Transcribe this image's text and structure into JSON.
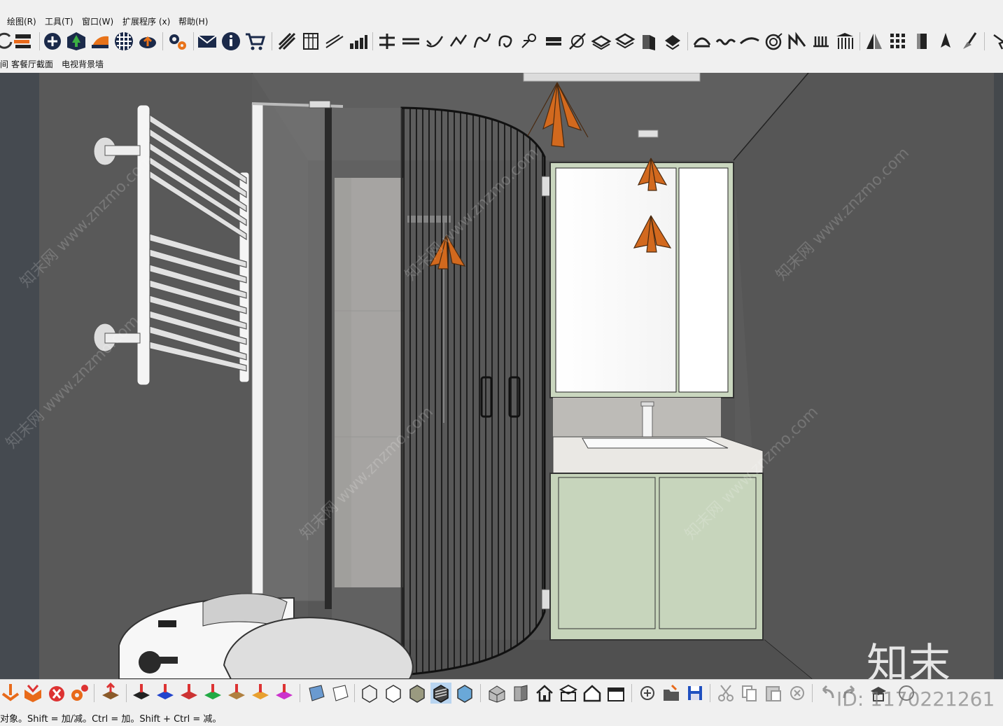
{
  "menubar": {
    "items": [
      "绘图(R)",
      "工具(T)",
      "窗口(W)",
      "扩展程序 (x)",
      "帮助(H)"
    ]
  },
  "toolbar_top": {
    "icons": [
      "rotate-icon",
      "layers-icon",
      "add-circle-icon",
      "house-green-icon",
      "sandbox-icon",
      "checker-sphere-icon",
      "cloud-upload-icon",
      "gear-icon",
      "mail-icon",
      "info-icon",
      "cart-icon",
      "stair-icon",
      "column-icon",
      "line-icon",
      "bar-chart-icon",
      "align-icon",
      "arc-icon",
      "curve-icon",
      "path-icon",
      "bezier-icon",
      "loop-icon",
      "node-icon",
      "flatten-icon",
      "draw-icon",
      "stack-icon",
      "stack2-icon",
      "extrude-icon",
      "push-icon",
      "shape-icon",
      "wave-icon",
      "spiral-icon",
      "roof-icon",
      "rail-icon",
      "temple-icon",
      "mirror-icon",
      "grid-icon",
      "panel-icon",
      "pen-icon",
      "brush-icon"
    ]
  },
  "scene_tabs": [
    "客餐厅截面",
    "电视背景墙"
  ],
  "scene_tab_prefix": "间",
  "toolbar_bottom": {
    "icons": [
      "drop-icon",
      "fold-icon",
      "bolt-icon",
      "gear2-icon",
      "move-up-icon",
      "arrow-red-icon",
      "arrow-blue-icon",
      "arrow-r-icon",
      "arrow-v-icon",
      "arrow-n-icon",
      "arrow-x-icon",
      "arrow-f-icon",
      "face-icon",
      "face2-icon",
      "box-wire-icon",
      "box-hidden-icon",
      "box-shaded-icon",
      "box-texture-icon",
      "box-mono-icon",
      "iso-icon",
      "front-icon",
      "home-icon",
      "top-icon",
      "house-icon",
      "side-icon",
      "zoom-icon",
      "open-icon",
      "save-icon",
      "cut-icon",
      "copy-icon",
      "paste-icon",
      "delete-icon",
      "undo-icon",
      "redo-icon",
      "print-icon",
      "help-icon"
    ]
  },
  "status": {
    "text": "对象。Shift = 加/减。Ctrl = 加。Shift + Ctrl = 减。"
  },
  "watermark": {
    "text": "知末网 www.znzmo.com",
    "logo": "知末",
    "id": "ID: 1170221261"
  },
  "colors": {
    "wall": "#5b5b5b",
    "cabinet": "#c9d6bd",
    "accent_orange": "#d2691e"
  }
}
